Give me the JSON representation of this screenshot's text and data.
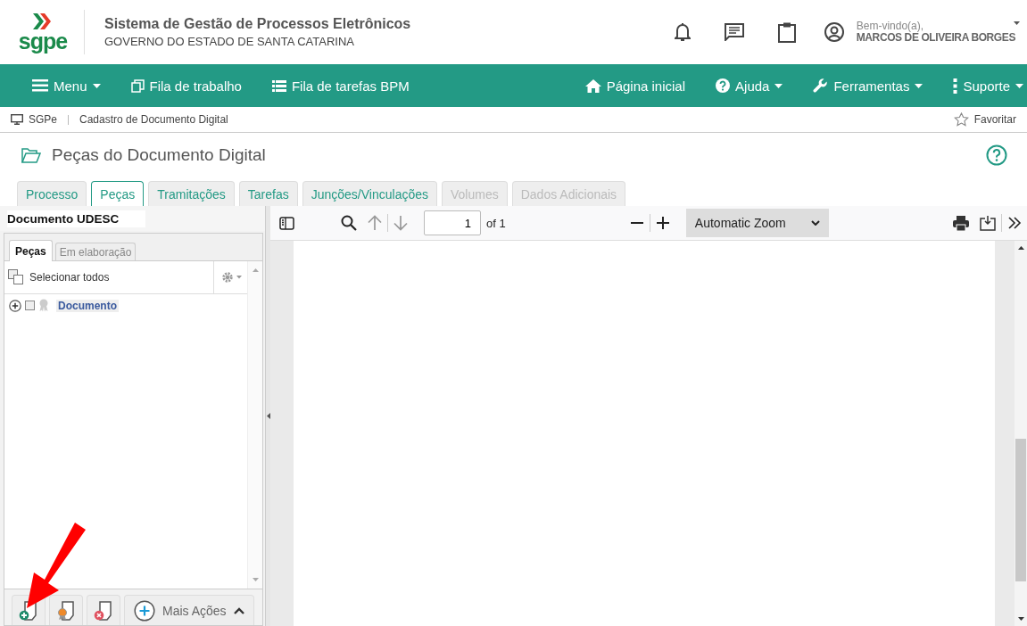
{
  "header": {
    "logo_text": "sgpe",
    "title": "Sistema de Gestão de Processos Eletrônicos",
    "subtitle": "GOVERNO DO ESTADO DE SANTA CATARINA",
    "welcome": "Bem-vindo(a),",
    "user": "MARCOS DE OLIVEIRA BORGES"
  },
  "nav": {
    "left": [
      {
        "label": "Menu",
        "dropdown": true
      },
      {
        "label": "Fila de trabalho",
        "dropdown": false
      },
      {
        "label": "Fila de tarefas BPM",
        "dropdown": false
      }
    ],
    "right": [
      {
        "label": "Página inicial",
        "dropdown": false
      },
      {
        "label": "Ajuda",
        "dropdown": true
      },
      {
        "label": "Ferramentas",
        "dropdown": true
      },
      {
        "label": "Suporte",
        "dropdown": true
      }
    ]
  },
  "breadcrumb": {
    "items": [
      "SGPe",
      "Cadastro de Documento Digital"
    ],
    "favorite": "Favoritar"
  },
  "page_title": "Peças do Documento Digital",
  "tabs": [
    {
      "label": "Processo",
      "selected": false,
      "disabled": false
    },
    {
      "label": "Peças",
      "selected": true,
      "disabled": false
    },
    {
      "label": "Tramitações",
      "selected": false,
      "disabled": false
    },
    {
      "label": "Tarefas",
      "selected": false,
      "disabled": false
    },
    {
      "label": "Junções/Vinculações",
      "selected": false,
      "disabled": false
    },
    {
      "label": "Volumes",
      "selected": false,
      "disabled": true
    },
    {
      "label": "Dados Adicionais",
      "selected": false,
      "disabled": true
    }
  ],
  "left_panel": {
    "title": "Documento UDESC",
    "tabs": [
      {
        "label": "Peças",
        "selected": true
      },
      {
        "label": "Em elaboração",
        "selected": false
      }
    ],
    "select_all": "Selecionar todos",
    "tree": [
      {
        "label": "Documento",
        "expanded": false,
        "checked": false
      }
    ],
    "more_actions": "Mais Ações"
  },
  "viewer": {
    "page_number": "1",
    "page_count": "of 1",
    "zoom": "Automatic Zoom"
  }
}
